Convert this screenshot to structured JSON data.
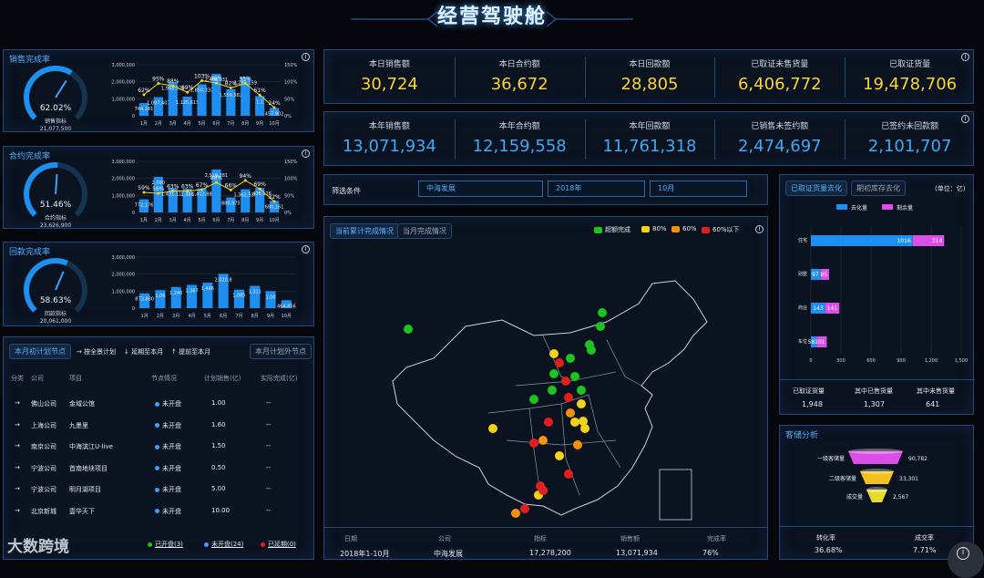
{
  "header": {
    "title": "经营驾驶舱"
  },
  "gauges": [
    {
      "title": "销售完成率",
      "percent": "62.02%",
      "pct": 0.6202,
      "sub_label": "销售指标",
      "sub_value": "21,077,500"
    },
    {
      "title": "合约完成率",
      "percent": "51.46%",
      "pct": 0.5146,
      "sub_label": "合约指标",
      "sub_value": "23,626,900"
    },
    {
      "title": "回款完成率",
      "percent": "58.63%",
      "pct": 0.5863,
      "sub_label": "回款指标",
      "sub_value": "20,061,000"
    }
  ],
  "chart_data": [
    {
      "type": "bar",
      "title": "销售完成率",
      "categories": [
        "1月",
        "2月",
        "3月",
        "4月",
        "5月",
        "6月",
        "7月",
        "8月",
        "9月",
        "10月"
      ],
      "yticks": [
        "0",
        "1,000,000",
        "2,000,000",
        "3,000,000"
      ],
      "y2ticks": [
        "0%",
        "50%",
        "100%",
        "150%"
      ],
      "ylim": [
        0,
        3000000
      ],
      "bars": [
        744181,
        1097407,
        1968378,
        1125615,
        1850332,
        2458131,
        1559582,
        2283159,
        1160000,
        457902
      ],
      "bar_labels": [
        "744,181",
        "1,097,407",
        "1,968,378",
        "1,125,615",
        "1,850,332",
        "2,468,131",
        "1,559,582",
        "2,283,159",
        "1,1",
        "457,902"
      ],
      "line": [
        0.62,
        0.95,
        0.88,
        0.69,
        1.03,
        0.96,
        0.82,
        0.95,
        0.61,
        0.24
      ],
      "line_labels": [
        "62%",
        "95%",
        "88%",
        "69%",
        "103%",
        "96%",
        "82%",
        "95%",
        "61%",
        "24%"
      ]
    },
    {
      "type": "bar",
      "title": "合约完成率",
      "categories": [
        "1月",
        "2月",
        "3月",
        "4月",
        "5月",
        "6月",
        "7月",
        "8月",
        "9月",
        "10月"
      ],
      "yticks": [
        "0",
        "1,000,000",
        "2,000,000",
        "3,000,000"
      ],
      "y2ticks": [
        "0%",
        "50%",
        "100%",
        "150%"
      ],
      "ylim": [
        0,
        3000000
      ],
      "bars": [
        772176,
        2090000,
        1431115,
        1386000,
        1412000,
        2519281,
        880975,
        1362136,
        1436126,
        680161
      ],
      "bar_labels": [
        "772,176",
        "2,090",
        "1,431,115",
        "1,386",
        "1,412,88",
        "2,519,281",
        "880,975",
        "1,362,136",
        "1,436,126",
        "680,161"
      ],
      "line": [
        0.59,
        0.56,
        0.63,
        0.63,
        0.67,
        0.88,
        0.66,
        0.94,
        0.69,
        0.32
      ],
      "line_labels": [
        "59%",
        "56%",
        "63%",
        "63%",
        "67%",
        "88%",
        "66%",
        "94%",
        "69%",
        "32%"
      ]
    },
    {
      "type": "bar",
      "title": "回款完成率",
      "categories": [
        "1月",
        "2月",
        "3月",
        "4月",
        "5月",
        "6月",
        "7月",
        "8月",
        "9月",
        "10月"
      ],
      "yticks": [
        "0",
        "1,000,000",
        "2,000,000",
        "3,000,000"
      ],
      "ylim": [
        0,
        3000000
      ],
      "bars": [
        873880,
        1060000,
        1240000,
        1367000,
        1496000,
        2020000,
        1085000,
        1311000,
        1000000,
        464856
      ],
      "bar_labels": [
        "873,880",
        "1,06",
        "1,240",
        "1,367",
        "1,496",
        "2,020,8",
        "1,085",
        "1,311",
        "1,00",
        "464,856"
      ]
    },
    {
      "type": "bar",
      "title": "已取证货量去化",
      "unit": "(单位：亿)",
      "legend": [
        "去化量",
        "剩余量"
      ],
      "categories": [
        "住宅",
        "别墅",
        "商业",
        "车位"
      ],
      "sold": [
        1016,
        97,
        143,
        58
      ],
      "remain": [
        314,
        85,
        141,
        101
      ],
      "xticks": [
        "0",
        "300",
        "600",
        "900",
        "1,200",
        "1,500"
      ],
      "xlim": [
        0,
        1500
      ]
    }
  ],
  "kpi_top": [
    {
      "label": "本日销售额",
      "value": "30,724"
    },
    {
      "label": "本日合约额",
      "value": "36,672"
    },
    {
      "label": "本日回款额",
      "value": "28,805"
    },
    {
      "label": "已取证未售货量",
      "value": "6,406,772"
    },
    {
      "label": "已取证货量",
      "value": "19,478,706"
    }
  ],
  "kpi_year": [
    {
      "label": "本年销售额",
      "value": "13,071,934"
    },
    {
      "label": "本年合约额",
      "value": "12,159,558"
    },
    {
      "label": "本年回款额",
      "value": "11,761,318"
    },
    {
      "label": "已销售未签约额",
      "value": "2,474,697"
    },
    {
      "label": "已签约未回款额",
      "value": "2,101,707"
    }
  ],
  "filter": {
    "label": "筛选条件",
    "company": "中海发展",
    "year": "2018年",
    "month": "10月"
  },
  "map": {
    "tabs": [
      "当前累计完成情况",
      "当月完成情况"
    ],
    "legend": [
      {
        "label": "超额完成",
        "color": "#1fc31f"
      },
      {
        "label": "80%",
        "color": "#f4d21b"
      },
      {
        "label": "60%",
        "color": "#f0920e"
      },
      {
        "label": "60%以下",
        "color": "#e0201e"
      }
    ],
    "table_headers": [
      "日期",
      "公司",
      "指标",
      "销售额",
      "完成率"
    ],
    "table_row": [
      "2018年1-10月",
      "中海发展",
      "17,278,200",
      "13,071,934",
      "76%"
    ]
  },
  "stock": {
    "tabs": [
      "已取证货量去化",
      "期初库存去化"
    ],
    "summary": [
      {
        "label": "已取证货量",
        "value": "1,948"
      },
      {
        "label": "其中已售货量",
        "value": "1,307"
      },
      {
        "label": "其中未售货量",
        "value": "641"
      }
    ]
  },
  "reserve": {
    "title": "客储分析",
    "levels": [
      {
        "label": "一级客储量",
        "value": "90,782",
        "color": "#d94fe8"
      },
      {
        "label": "二级客储量",
        "value": "33,301",
        "color": "#f3c21e"
      },
      {
        "label": "成交量",
        "value": "2,567",
        "color": "#e6dc2c"
      }
    ],
    "footer": [
      {
        "label": "转化率",
        "value": "36.68%"
      },
      {
        "label": "成交率",
        "value": "7.71%"
      }
    ]
  },
  "nodes": {
    "tabs": [
      "本月初计划节点",
      "本月计划外节点"
    ],
    "hint_items": [
      "→ 按全景计划",
      "↓ 延期至本月",
      "↑ 提前至本月"
    ],
    "headers": [
      "分类",
      "公司",
      "项目",
      "节点情况",
      "计划销售(亿)",
      "实际完成(亿)"
    ],
    "rows": [
      {
        "arrow": "→",
        "company": "佛山公司",
        "project": "金域公馆",
        "status": "未开盘",
        "plan": "1.00",
        "actual": "--"
      },
      {
        "arrow": "→",
        "company": "上海公司",
        "project": "九墨里",
        "status": "未开盘",
        "plan": "1.60",
        "actual": "--"
      },
      {
        "arrow": "→",
        "company": "南京公司",
        "project": "中海滨江U-live",
        "status": "未开盘",
        "plan": "1.50",
        "actual": "--"
      },
      {
        "arrow": "→",
        "company": "宁波公司",
        "project": "首南地块项目",
        "status": "未开盘",
        "plan": "0.50",
        "actual": "--"
      },
      {
        "arrow": "→",
        "company": "宁波公司",
        "project": "明月湖项目",
        "status": "未开盘",
        "plan": "5.00",
        "actual": "--"
      },
      {
        "arrow": "→",
        "company": "北京新城",
        "project": "壹华天下",
        "status": "未开盘",
        "plan": "10.00",
        "actual": "--"
      }
    ],
    "footer": [
      {
        "label": "已开盘(3)",
        "color": "#1fc31f"
      },
      {
        "label": "未开盘(24)",
        "color": "#3aa0ff"
      },
      {
        "label": "已延期(0)",
        "color": "#e0201e"
      }
    ]
  },
  "watermark": "大数跨境"
}
